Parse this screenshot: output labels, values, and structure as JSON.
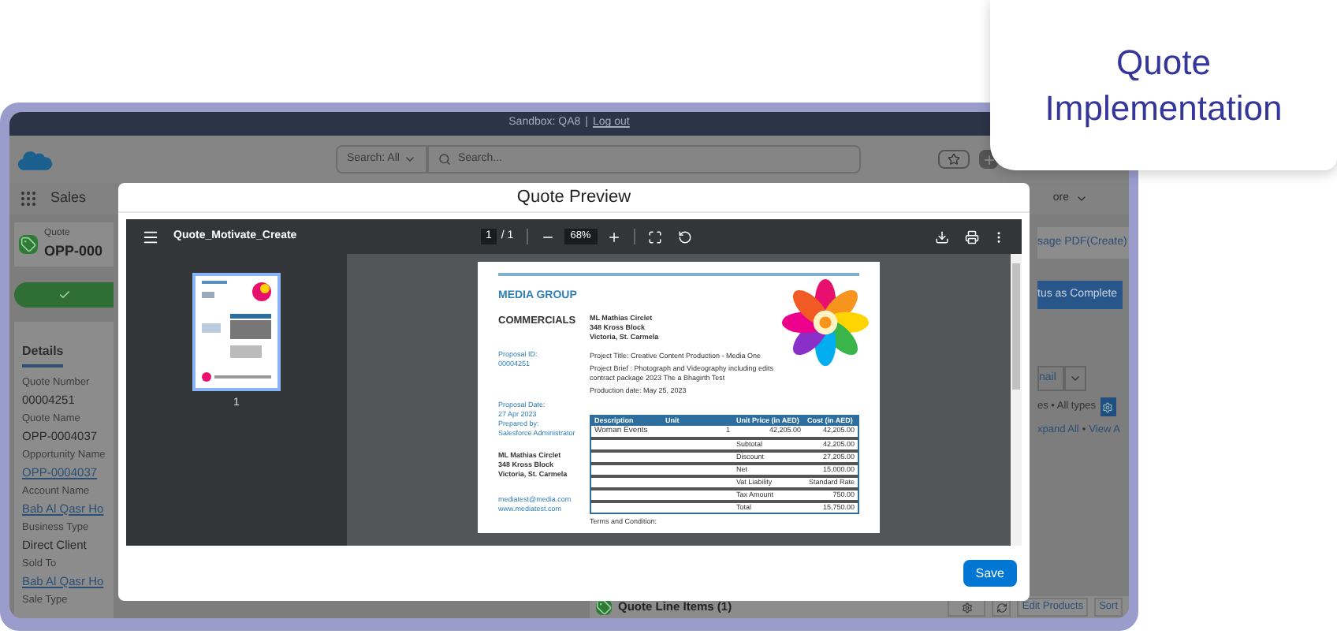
{
  "badge": {
    "title": "Quote Implementation"
  },
  "app": {
    "top_bar": {
      "org": "Sandbox: QA8",
      "separator": "|",
      "logout": "Log out"
    },
    "search": {
      "scope": "Search: All",
      "placeholder": "Search..."
    },
    "app_name": "Sales",
    "more_tab": "ore",
    "record": {
      "type": "Quote",
      "name": "OPP-000"
    },
    "path": [
      {
        "complete": true
      }
    ],
    "tabs": [
      {
        "label": "Details",
        "selected": true
      }
    ],
    "fields": [
      {
        "label": "Quote Number",
        "value": "00004251",
        "link": false
      },
      {
        "label": "Quote Name",
        "value": "OPP-0004037",
        "link": false
      },
      {
        "label": "Opportunity Name",
        "value": "OPP-0004037",
        "link": true
      },
      {
        "label": "Account Name",
        "value": "Bab Al Qasr Ho",
        "link": true
      },
      {
        "label": "Business Type",
        "value": "Direct Client",
        "link": false
      },
      {
        "label": "Sold To",
        "value": "Bab Al Qasr Ho",
        "link": true
      },
      {
        "label": "Sale Type"
      }
    ],
    "side": {
      "pdf_button": "sage PDF(Create)",
      "complete_button": "tus as Complete",
      "email_select": "nail",
      "filter": "es • All types",
      "expand_link": "xpand All",
      "dot": "•",
      "view_link": "View A"
    },
    "related": {
      "title": "Quote Line Items (1)",
      "buttons": [
        "Edit Products",
        "Sort"
      ]
    }
  },
  "modal": {
    "title": "Quote Preview",
    "save": "Save",
    "viewer": {
      "file": "Quote_Motivate_Create",
      "page": "1",
      "pages": "/ 1",
      "zoom": "68%",
      "thumbnails": [
        {
          "label": "1",
          "selected": true
        }
      ]
    },
    "document": {
      "company": "MEDIA GROUP",
      "heading": "COMMERCIALS",
      "address": [
        "ML Mathias Circlet",
        "348 Kross Block",
        "Victoria, St. Carmela"
      ],
      "proposal_id_label": "Proposal ID:",
      "proposal_id": "00004251",
      "project_title": "Project Title: Creative Content Production - Media One",
      "project_brief": "Project Brief : Photograph and Videography including edits contract package 2023 The a Bhagirth Test",
      "production_date": "Production date: May 25, 2023",
      "proposal_date_label": "Proposal Date:",
      "proposal_date": "27 Apr 2023",
      "prepared_by_label": "Prepared by:",
      "prepared_by": "Salesforce Administrator",
      "footer_address": [
        "ML Mathias Circlet",
        "348 Kross Block",
        "Victoria, St. Carmela"
      ],
      "email": "mediatest@media.com",
      "website": "www.mediatest.com",
      "table": {
        "columns": [
          "Description",
          "Unit",
          "Unit Price (in AED)",
          "Cost (in AED)"
        ],
        "rows": [
          [
            "Woman Events",
            "1",
            "42,205.00",
            "42,205.00"
          ]
        ],
        "totals": [
          {
            "label": "Subtotal",
            "value": "42,205.00"
          },
          {
            "label": "Discount",
            "value": "27,205.00"
          },
          {
            "label": "Net",
            "value": "15,000.00"
          },
          {
            "label": "Vat Liability",
            "value": "Standard Rate"
          },
          {
            "label": "Tax Amount",
            "value": "750.00"
          },
          {
            "label": "Total",
            "value": "15,750.00"
          }
        ]
      },
      "terms": "Terms and Condition:"
    }
  }
}
